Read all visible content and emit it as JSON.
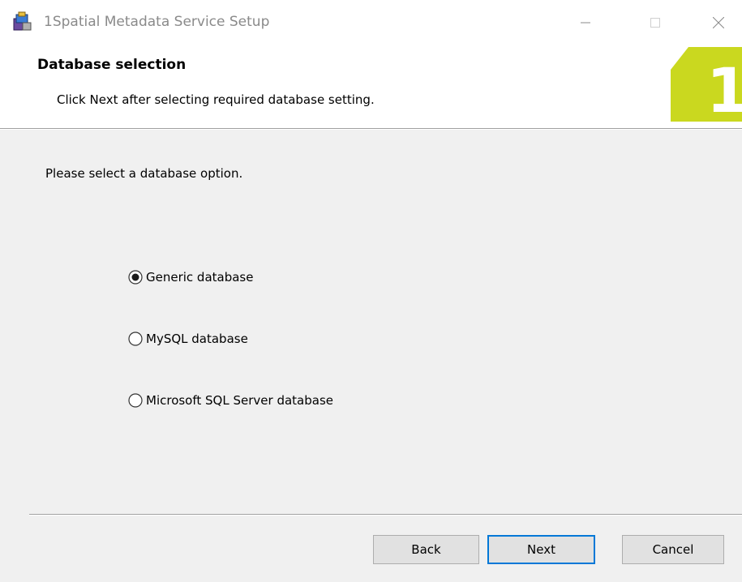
{
  "window": {
    "title": "1Spatial Metadata Service Setup",
    "icon": "installer-icon",
    "controls": [
      "minimize-icon",
      "maximize-icon",
      "close-icon"
    ]
  },
  "header": {
    "title": "Database selection",
    "subtitle": "Click Next after selecting required database setting.",
    "logo": {
      "text": "1",
      "color": "#cad81f"
    }
  },
  "body": {
    "prompt": "Please select a database option.",
    "options": [
      {
        "label": "Generic database",
        "selected": true
      },
      {
        "label": "MySQL database",
        "selected": false
      },
      {
        "label": "Microsoft SQL Server database",
        "selected": false
      }
    ]
  },
  "buttons": {
    "back": "Back",
    "next": "Next",
    "cancel": "Cancel"
  },
  "colors": {
    "accent": "#0078d7",
    "brand": "#cad81f"
  }
}
